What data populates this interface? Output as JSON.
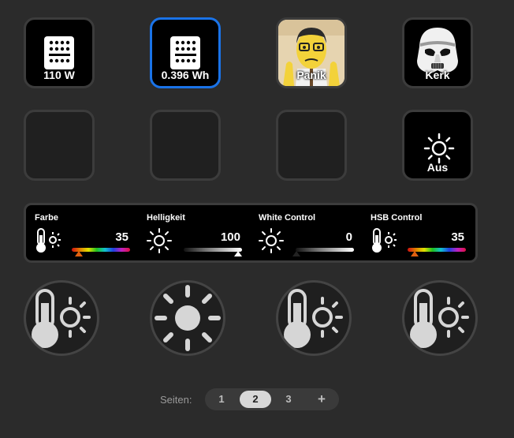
{
  "keys_row1": [
    {
      "label": "110 W",
      "icon": "outlet-icon"
    },
    {
      "label": "0.396 Wh",
      "icon": "outlet-icon",
      "selected": true
    },
    {
      "label": "Panik",
      "icon": "cartoon-character-icon"
    },
    {
      "label": "Kerk",
      "icon": "stormtrooper-helmet-icon"
    }
  ],
  "keys_row2": [
    {
      "label": ""
    },
    {
      "label": ""
    },
    {
      "label": ""
    },
    {
      "label": "Aus",
      "icon": "sun-icon"
    }
  ],
  "touch_strip": [
    {
      "title": "Farbe",
      "value": "35",
      "icon": "thermometer-sun-icon",
      "bar": "rgb",
      "level": 0.12
    },
    {
      "title": "Helligkeit",
      "value": "100",
      "icon": "sun-icon",
      "bar": "white",
      "level": 1.0
    },
    {
      "title": "White Control",
      "value": "0",
      "icon": "sun-icon",
      "bar": "white",
      "level": 0.0
    },
    {
      "title": "HSB Control",
      "value": "35",
      "icon": "thermometer-sun-icon",
      "bar": "rgb",
      "level": 0.12
    }
  ],
  "dials": [
    "thermometer-sun-icon",
    "sun-icon",
    "thermometer-sun-icon",
    "thermometer-sun-icon"
  ],
  "pager": {
    "label": "Seiten:",
    "pages": [
      "1",
      "2",
      "3"
    ],
    "active": "2",
    "add": "+"
  },
  "colors": {
    "background": "#2b2b2b",
    "selected_border": "#1a73e8",
    "rgb_marker": "#e06010"
  }
}
